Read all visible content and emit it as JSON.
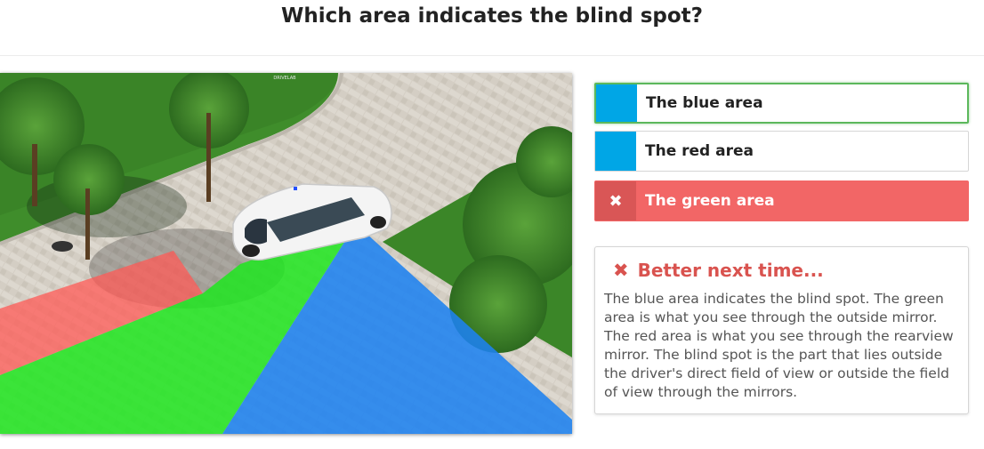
{
  "question": {
    "title": "Which area indicates the blind spot?"
  },
  "scene": {
    "image_caption": "Aerial view of a white car in a driveway with red, green and blue shaded areas",
    "watermark": "DRIVELAB",
    "colors": {
      "red_area": "#ff5a55",
      "green_area": "#1ee61e",
      "blue_area": "#1e82f0",
      "grass": "#3d8a2a",
      "pavement": "#d3cdc3"
    }
  },
  "answers": [
    {
      "label": "The blue area",
      "swatch_color": "#00a6e6",
      "state": "correct"
    },
    {
      "label": "The red area",
      "swatch_color": "#00a6e6",
      "state": "neutral"
    },
    {
      "label": "The green area",
      "swatch_color": "#d95656",
      "state": "selected-wrong",
      "icon": "close-icon"
    }
  ],
  "feedback": {
    "icon": "close-icon",
    "title": "Better next time...",
    "text": "The blue area indicates the blind spot. The green area is what you see through the outside mirror. The red area is what you see through the rearview mirror. The blind spot is the part that lies outside the driver's direct field of view or outside the field of view through the mirrors."
  }
}
